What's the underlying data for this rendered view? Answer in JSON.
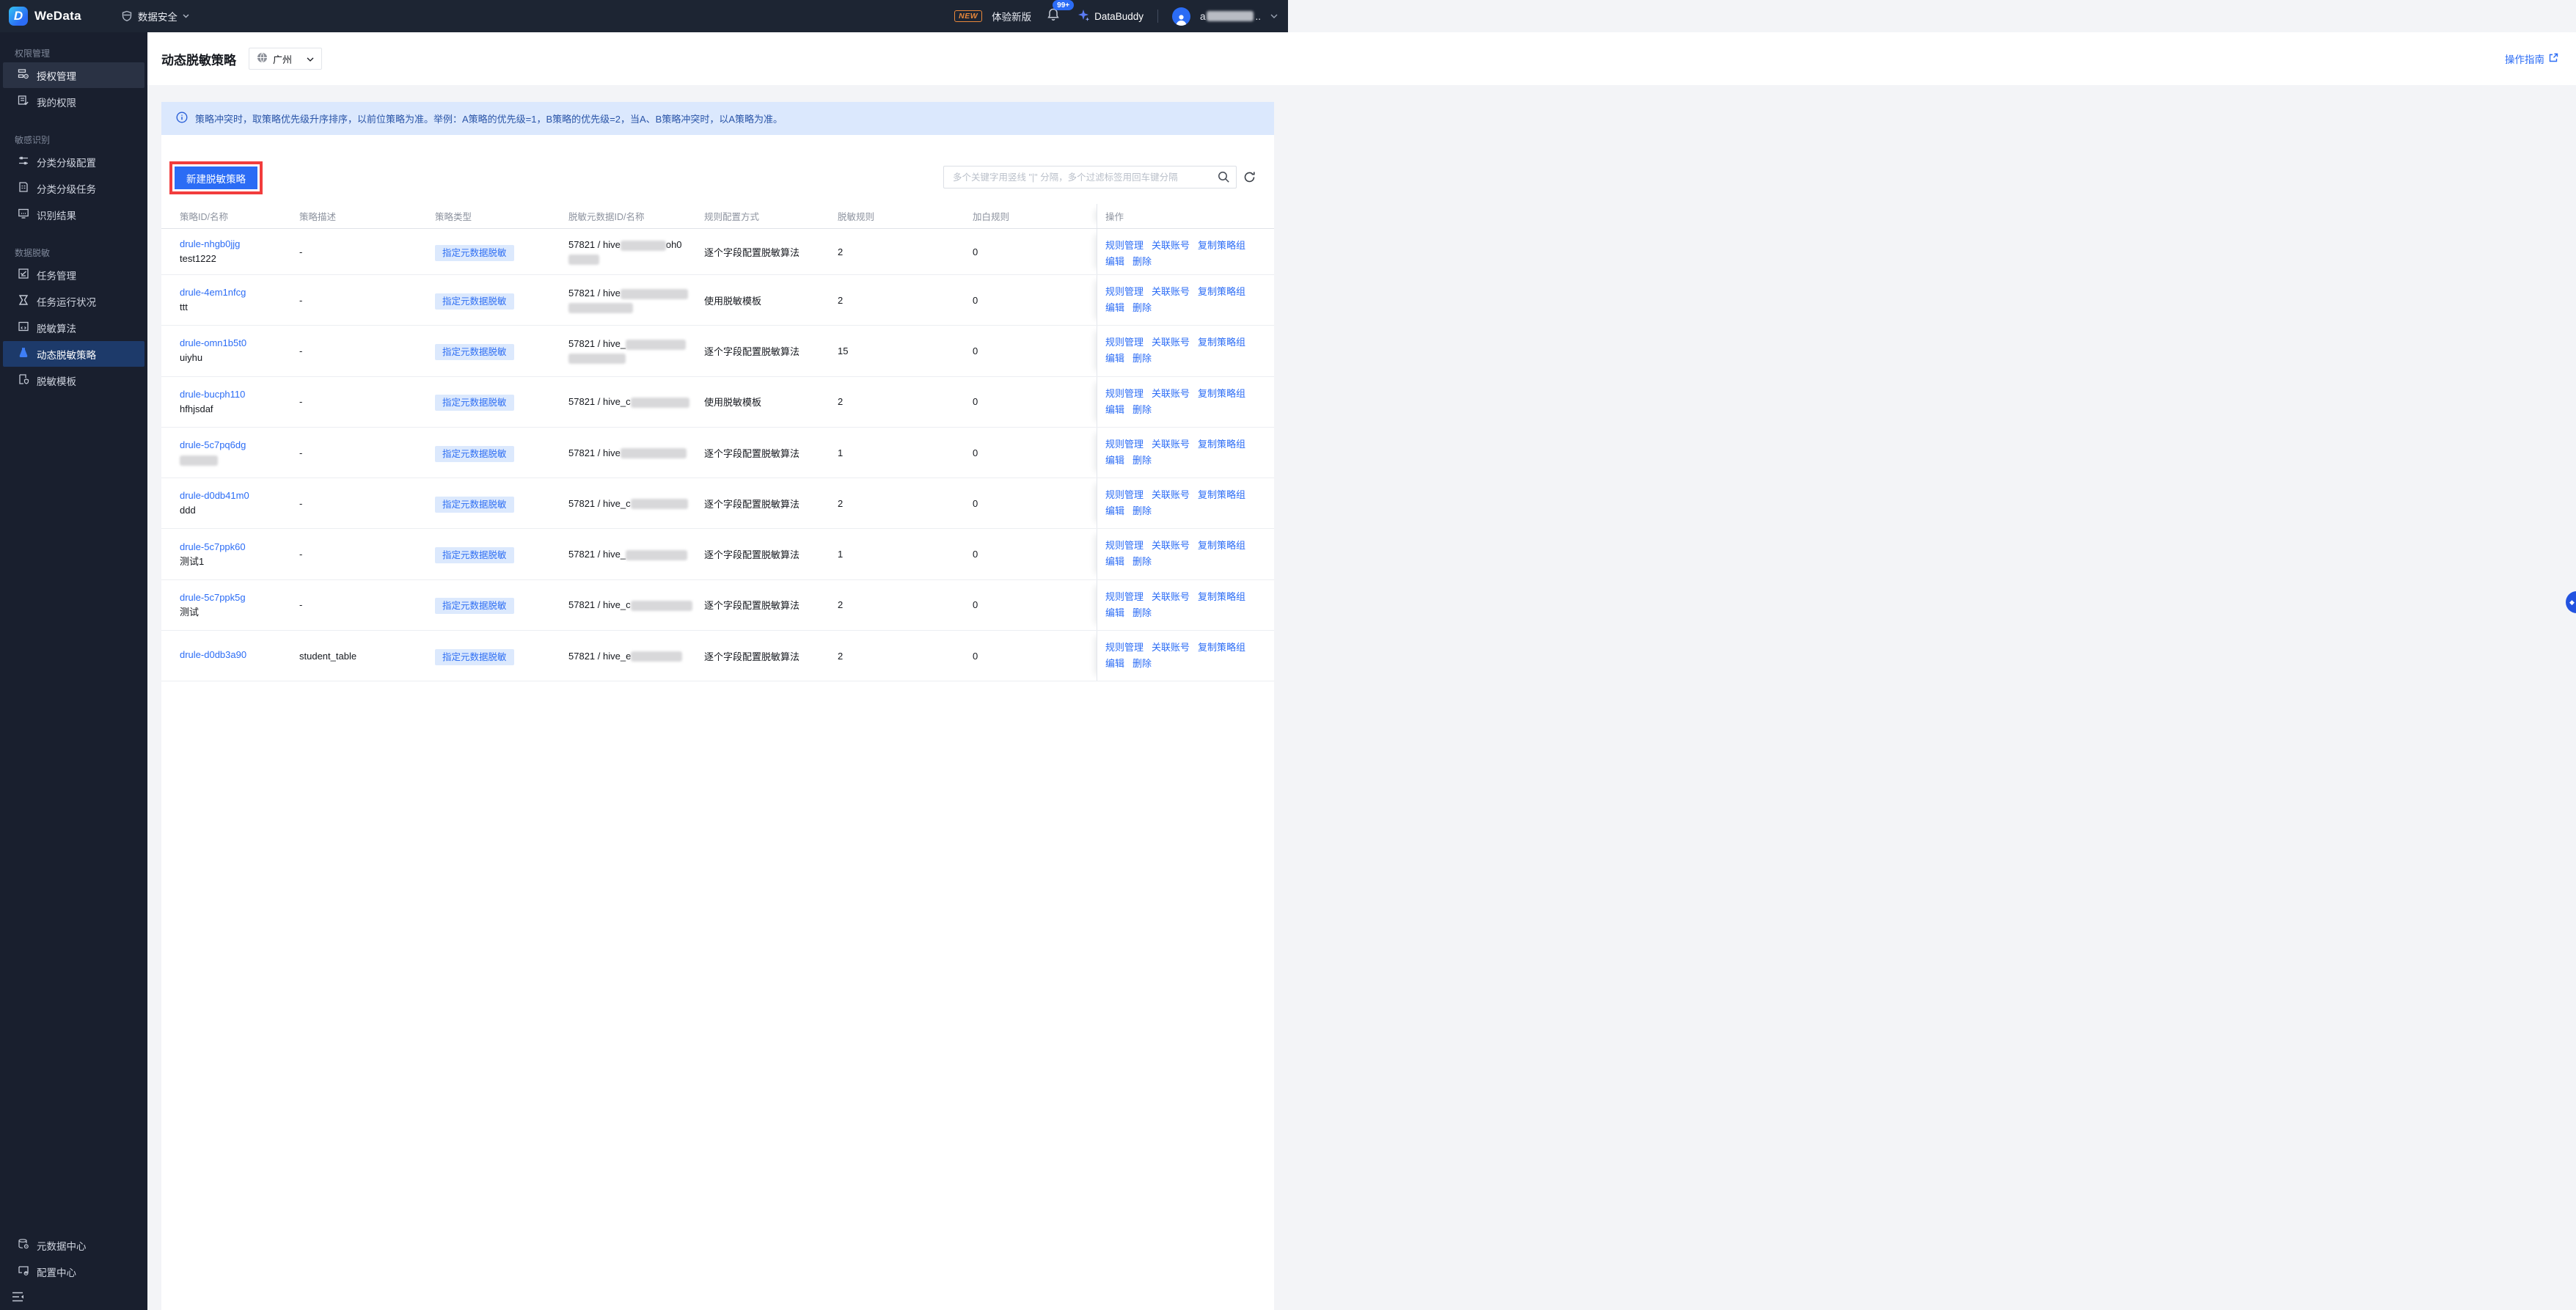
{
  "topbar": {
    "product": "WeData",
    "nav_item": "数据安全",
    "new_badge": "NEW",
    "try_new": "体验新版",
    "notif_count": "99+",
    "databuddy": "DataBuddy",
    "user_prefix": "a",
    "user_suffix": ".."
  },
  "sidebar": {
    "sections": [
      {
        "title": "权限管理",
        "items": [
          {
            "label": "授权管理",
            "icon": "grid-gear-icon",
            "active": "hover"
          },
          {
            "label": "我的权限",
            "icon": "list-check-icon"
          }
        ]
      },
      {
        "title": "敏感识别",
        "items": [
          {
            "label": "分类分级配置",
            "icon": "sliders-icon"
          },
          {
            "label": "分类分级任务",
            "icon": "doc-list-icon"
          },
          {
            "label": "识别结果",
            "icon": "monitor-icon"
          }
        ]
      },
      {
        "title": "数据脱敏",
        "items": [
          {
            "label": "任务管理",
            "icon": "task-icon"
          },
          {
            "label": "任务运行状况",
            "icon": "hourglass-icon"
          },
          {
            "label": "脱敏算法",
            "icon": "code-window-icon"
          },
          {
            "label": "动态脱敏策略",
            "icon": "flask-icon",
            "active": "primary"
          },
          {
            "label": "脱敏模板",
            "icon": "doc-shield-icon"
          }
        ]
      }
    ],
    "bottom_items": [
      {
        "label": "元数据中心",
        "icon": "database-gear-icon"
      },
      {
        "label": "配置中心",
        "icon": "box-gear-icon"
      }
    ]
  },
  "page": {
    "title": "动态脱敏策略",
    "region": "广州",
    "guide_link": "操作指南",
    "banner": "策略冲突时，取策略优先级升序排序，以前位策略为准。举例：A策略的优先级=1，B策略的优先级=2，当A、B策略冲突时，以A策略为准。",
    "create_button": "新建脱敏策略",
    "search_placeholder": "多个关键字用竖线 \"|\" 分隔，多个过滤标签用回车键分隔"
  },
  "table": {
    "headers": [
      "策略ID/名称",
      "策略描述",
      "策略类型",
      "脱敏元数据ID/名称",
      "规则配置方式",
      "脱敏规则",
      "加白规则",
      "操作"
    ],
    "row_actions_line1": [
      "规则管理",
      "关联账号",
      "复制策略组"
    ],
    "row_actions_line2": [
      "编辑",
      "删除"
    ],
    "rows": [
      {
        "id": "drule-nhgb0jjg",
        "name": "test1222",
        "desc": "-",
        "type": "指定元数据脱敏",
        "meta_prefix": "57821 / hive",
        "meta_mask_w": 62,
        "meta_suffix": "oh0",
        "meta_mask2_w": 42,
        "mode": "逐个字段配置脱敏算法",
        "rules": "2",
        "white": "0"
      },
      {
        "id": "drule-4em1nfcg",
        "name": "ttt",
        "desc": "-",
        "type": "指定元数据脱敏",
        "meta_prefix": "57821 / hive",
        "meta_mask_w": 92,
        "meta_suffix": "",
        "meta_mask2_w": 88,
        "mode": "使用脱敏模板",
        "rules": "2",
        "white": "0"
      },
      {
        "id": "drule-omn1b5t0",
        "name": "uiyhu",
        "desc": "-",
        "type": "指定元数据脱敏",
        "meta_prefix": "57821 / hive_",
        "meta_mask_w": 82,
        "meta_suffix": "",
        "meta_mask2_w": 78,
        "mode": "逐个字段配置脱敏算法",
        "rules": "15",
        "white": "0"
      },
      {
        "id": "drule-bucph110",
        "name": "hfhjsdaf",
        "desc": "-",
        "type": "指定元数据脱敏",
        "meta_prefix": "57821 / hive_c",
        "meta_mask_w": 80,
        "meta_suffix": "",
        "meta_mask2_w": 0,
        "mode": "使用脱敏模板",
        "rules": "2",
        "white": "0"
      },
      {
        "id": "drule-5c7pq6dg",
        "name": "",
        "name_mask_w": 52,
        "desc": "-",
        "type": "指定元数据脱敏",
        "meta_prefix": "57821 / hive",
        "meta_mask_w": 90,
        "meta_suffix": "",
        "meta_mask2_w": 0,
        "mode": "逐个字段配置脱敏算法",
        "rules": "1",
        "white": "0"
      },
      {
        "id": "drule-d0db41m0",
        "name": "ddd",
        "desc": "-",
        "type": "指定元数据脱敏",
        "meta_prefix": "57821 / hive_c",
        "meta_mask_w": 78,
        "meta_suffix": "",
        "meta_mask2_w": 0,
        "mode": "逐个字段配置脱敏算法",
        "rules": "2",
        "white": "0"
      },
      {
        "id": "drule-5c7ppk60",
        "name": "测试1",
        "desc": "-",
        "type": "指定元数据脱敏",
        "meta_prefix": "57821 / hive_",
        "meta_mask_w": 84,
        "meta_suffix": "",
        "meta_mask2_w": 0,
        "mode": "逐个字段配置脱敏算法",
        "rules": "1",
        "white": "0"
      },
      {
        "id": "drule-5c7ppk5g",
        "name": "测试",
        "desc": "-",
        "type": "指定元数据脱敏",
        "meta_prefix": "57821 / hive_c",
        "meta_mask_w": 84,
        "meta_suffix": "",
        "meta_mask2_w": 0,
        "mode": "逐个字段配置脱敏算法",
        "rules": "2",
        "white": "0"
      },
      {
        "id": "drule-d0db3a90",
        "name": "",
        "desc": "student_table",
        "type": "指定元数据脱敏",
        "meta_prefix": "57821 / hive_e",
        "meta_mask_w": 70,
        "meta_suffix": "",
        "meta_mask2_w": 0,
        "mode": "逐个字段配置脱敏算法",
        "rules": "2",
        "white": "0"
      }
    ]
  },
  "colors": {
    "accent": "#2b6cf5",
    "annotation_red": "#f23d3d",
    "banner_bg": "#dbe8fd",
    "banner_text": "#2a55a8",
    "topbar_bg": "#1d2533",
    "sidebar_bg": "#191f2e",
    "active_item_bg": "#1d3a6a",
    "badge_bg": "#dce9fd",
    "page_bg": "#f3f4f7"
  }
}
